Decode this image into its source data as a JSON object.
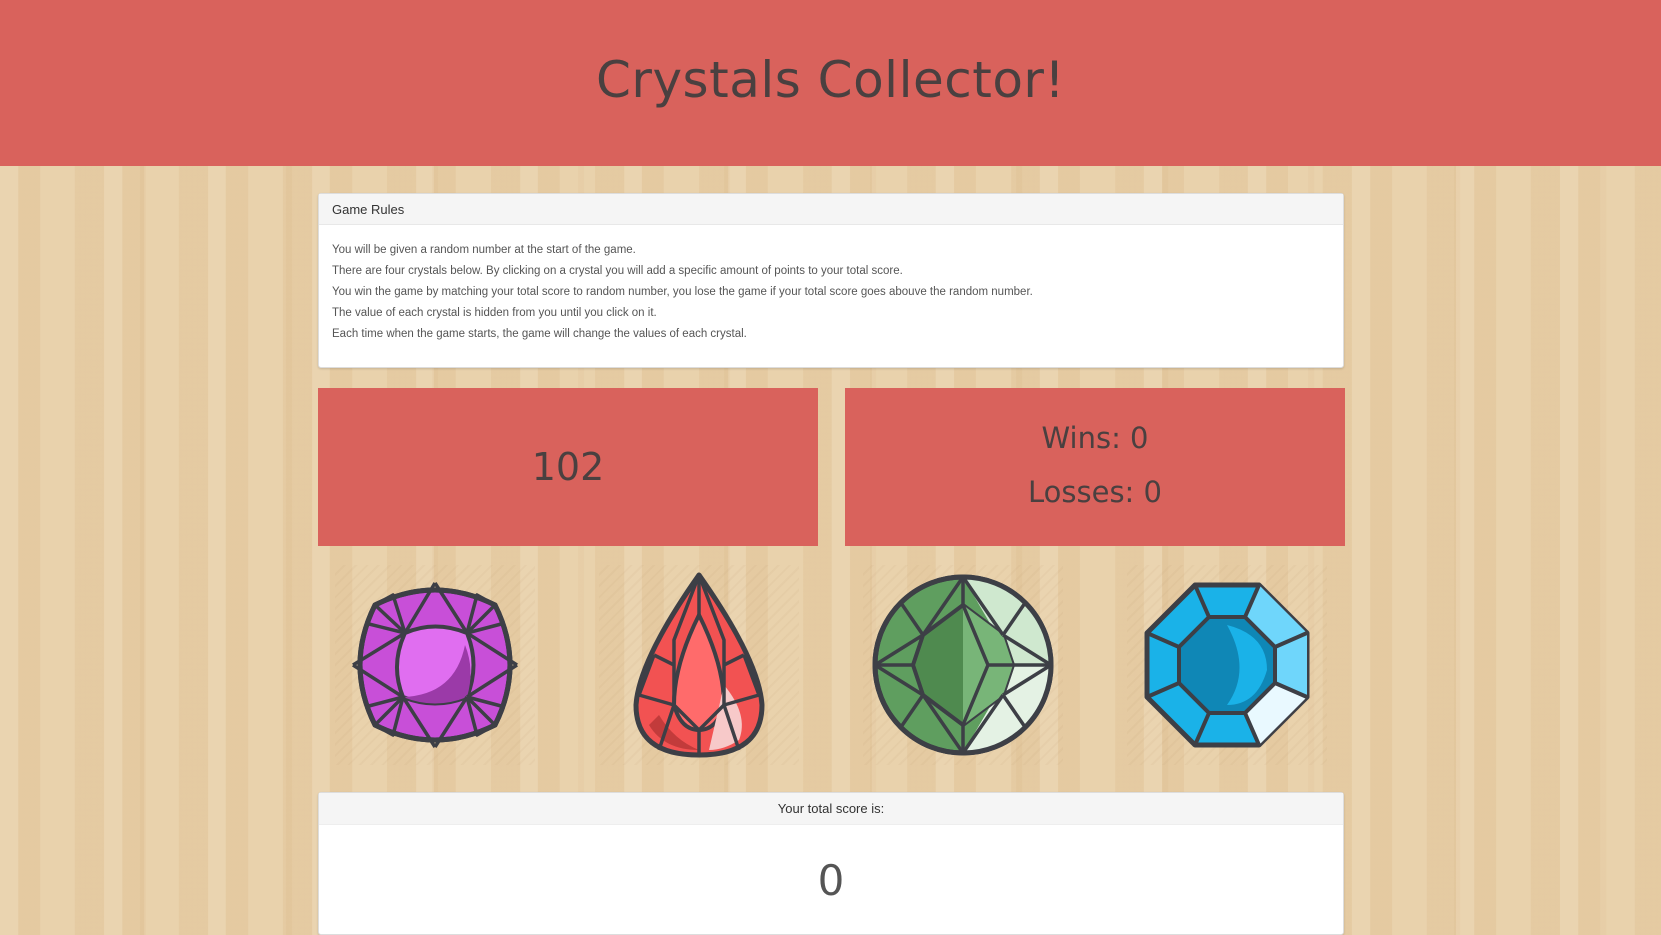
{
  "header": {
    "title": "Crystals Collector!"
  },
  "rules": {
    "heading": "Game Rules",
    "lines": [
      "You will be given a random number at the start of the game.",
      "There are four crystals below. By clicking on a crystal you will add a specific amount of points to your total score.",
      "You win the game by matching your total score to random number, you lose the game if your total score goes abouve the random number.",
      "The value of each crystal is hidden from you until you click on it.",
      "Each time when the game starts, the game will change the values of each crystal."
    ]
  },
  "target": {
    "number": "102"
  },
  "stats": {
    "wins": "Wins: 0",
    "losses": "Losses: 0"
  },
  "crystals": [
    {
      "name": "purple-crystal",
      "color": "#c84fd8"
    },
    {
      "name": "red-crystal",
      "color": "#f25252"
    },
    {
      "name": "green-crystal",
      "color": "#5f9e5f"
    },
    {
      "name": "blue-crystal",
      "color": "#1ab2e8"
    }
  ],
  "score": {
    "heading": "Your total score is:",
    "value": "0"
  },
  "colors": {
    "accent": "#d9625c",
    "background": "#e8cfa7",
    "outline": "#3d3f46"
  }
}
